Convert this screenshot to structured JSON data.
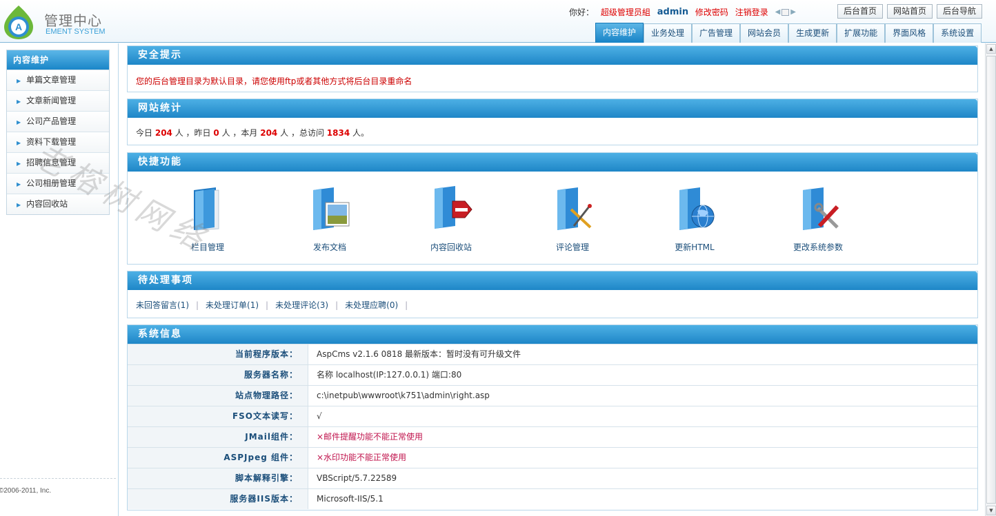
{
  "brand": {
    "title": "管理中心",
    "subtitle": "EMENT SYSTEM"
  },
  "userbar": {
    "greeting": "你好：",
    "role": "超级管理员組",
    "username": "admin",
    "change_password": "修改密码",
    "logout": "注销登录"
  },
  "top_buttons": [
    "后台首页",
    "网站首页",
    "后台导航"
  ],
  "tabs": [
    "内容维护",
    "业务处理",
    "广告管理",
    "网站会员",
    "生成更新",
    "扩展功能",
    "界面风格",
    "系统设置"
  ],
  "sidebar": {
    "title": "内容维护",
    "items": [
      "单篇文章管理",
      "文章新闻管理",
      "公司产品管理",
      "资料下载管理",
      "招聘信息管理",
      "公司相册管理",
      "内容回收站"
    ],
    "copyright": "©2006-2011, Inc."
  },
  "security": {
    "title": "安全提示",
    "message": "您的后台管理目录为默认目录，请您使用ftp或者其他方式将后台目录重命名"
  },
  "stats": {
    "title": "网站统计",
    "today_label": "今日",
    "today": "204",
    "yesterday_label": "人 ，昨日",
    "yesterday": "0",
    "month_label": "人 ，本月",
    "month": "204",
    "total_label": "人 ，总访问",
    "total": "1834",
    "end_label": "人。"
  },
  "quick": {
    "title": "快捷功能",
    "items": [
      "栏目管理",
      "发布文档",
      "内容回收站",
      "评论管理",
      "更新HTML",
      "更改系统参数"
    ]
  },
  "todo": {
    "title": "待处理事项",
    "items": [
      "未回答留言(1)",
      "未处理订单(1)",
      "未处理评论(3)",
      "未处理应聘(0)"
    ]
  },
  "system": {
    "title": "系统信息",
    "rows": [
      {
        "key": "当前程序版本：",
        "value": "AspCms v2.1.6 0818 最新版本：暂时没有可升级文件"
      },
      {
        "key": "服务器名称：",
        "value": "名称  localhost(IP:127.0.0.1) 端口:80"
      },
      {
        "key": "站点物理路径：",
        "value": "c:\\inetpub\\wwwroot\\k751\\admin\\right.asp"
      },
      {
        "key": "FSO文本读写：",
        "value": "√"
      },
      {
        "key": "JMail组件：",
        "value": "×邮件提醒功能不能正常使用"
      },
      {
        "key": "ASPJpeg 组件：",
        "value": "×水印功能不能正常使用"
      },
      {
        "key": "脚本解释引擎：",
        "value": "VBScript/5.7.22589"
      },
      {
        "key": "服务器IIS版本：",
        "value": "Microsoft-IIS/5.1"
      }
    ]
  },
  "watermark": "老榕树网络",
  "colors": {
    "accent": "#1e86c7",
    "alert": "#d00000",
    "link": "#1b4e7a"
  }
}
